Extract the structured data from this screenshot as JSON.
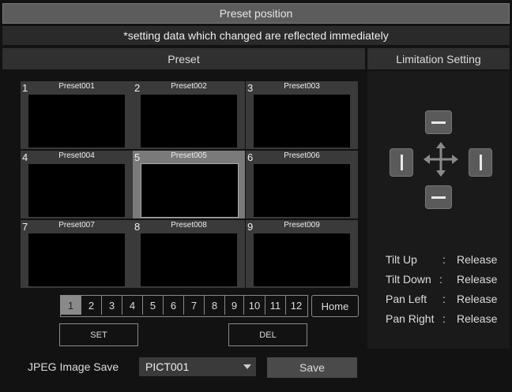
{
  "window": {
    "title": "Preset position"
  },
  "notice": "*setting data which changed are reflected immediately",
  "preset_header": "Preset",
  "limit_header": "Limitation Setting",
  "presets": [
    {
      "num": "1",
      "label": "Preset001"
    },
    {
      "num": "2",
      "label": "Preset002"
    },
    {
      "num": "3",
      "label": "Preset003"
    },
    {
      "num": "4",
      "label": "Preset004"
    },
    {
      "num": "5",
      "label": "Preset005",
      "selected": true
    },
    {
      "num": "6",
      "label": "Preset006"
    },
    {
      "num": "7",
      "label": "Preset007"
    },
    {
      "num": "8",
      "label": "Preset008"
    },
    {
      "num": "9",
      "label": "Preset009"
    }
  ],
  "pages": [
    "1",
    "2",
    "3",
    "4",
    "5",
    "6",
    "7",
    "8",
    "9",
    "10",
    "11",
    "12"
  ],
  "active_page": "1",
  "buttons": {
    "home": "Home",
    "set": "SET",
    "del": "DEL",
    "save": "Save"
  },
  "jpeg": {
    "label": "JPEG Image Save",
    "selected": "PICT001"
  },
  "limits": [
    {
      "name": "Tilt Up",
      "sep": ":",
      "value": "Release"
    },
    {
      "name": "Tilt Down",
      "sep": ":",
      "value": "Release"
    },
    {
      "name": "Pan Left",
      "sep": ":",
      "value": "Release"
    },
    {
      "name": "Pan Right",
      "sep": ":",
      "value": "Release"
    }
  ],
  "icons": {
    "move": "move-arrows-icon",
    "limit_up": "minus-icon",
    "limit_down": "minus-icon",
    "limit_left": "bar-icon",
    "limit_right": "bar-icon"
  }
}
